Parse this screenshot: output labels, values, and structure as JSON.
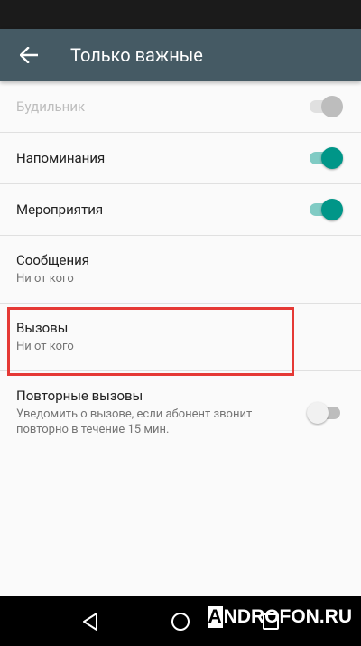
{
  "toolbar": {
    "title": "Только важные",
    "back_icon": "arrow-back-icon"
  },
  "settings": [
    {
      "title": "Будильник",
      "subtitle": "",
      "switch": "on",
      "disabled": true
    },
    {
      "title": "Напоминания",
      "subtitle": "",
      "switch": "on",
      "disabled": false
    },
    {
      "title": "Мероприятия",
      "subtitle": "",
      "switch": "on",
      "disabled": false
    },
    {
      "title": "Сообщения",
      "subtitle": "Ни от кого",
      "switch": null,
      "disabled": false
    },
    {
      "title": "Вызовы",
      "subtitle": "Ни от кого",
      "switch": null,
      "disabled": false
    },
    {
      "title": "Повторные вызовы",
      "subtitle": "Уведомить о вызове, если абонент звонит повторно в течение 15 мин.",
      "switch": "off",
      "disabled": false
    }
  ],
  "watermark": {
    "first": "A",
    "rest": "NDROFON.RU"
  },
  "colors": {
    "toolbar": "#455a64",
    "accent": "#009688",
    "highlight": "#e53935"
  },
  "nav_icons": [
    "back-triangle-icon",
    "home-circle-icon",
    "recents-square-icon"
  ]
}
